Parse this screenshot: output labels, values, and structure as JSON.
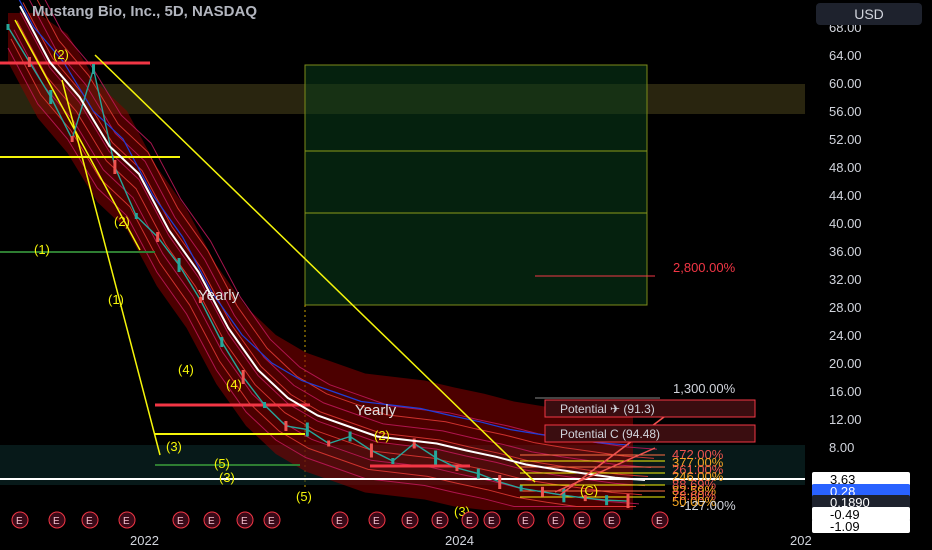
{
  "header": {
    "title": "Mustang Bio, Inc., 5D, NASDAQ",
    "currency": "USD"
  },
  "colors": {
    "background": "#000000",
    "price_axis_text": "#d1d4dc",
    "ma_red": "#c2185b",
    "ribbon": "#8b0000",
    "fib_yellow": "#f5f50a",
    "target_zone": "#0a3d1a",
    "current_price_line": "#ffffff"
  },
  "chart_data": {
    "type": "line",
    "title": "Mustang Bio, Inc., 5D, NASDAQ",
    "ylim": [
      -1.09,
      70
    ],
    "y_ticks": [
      "68.00",
      "64.00",
      "60.00",
      "56.00",
      "52.00",
      "48.00",
      "44.00",
      "40.00",
      "36.00",
      "32.00",
      "28.00",
      "24.00",
      "20.00",
      "16.00",
      "12.00",
      "8.00"
    ],
    "x_ticks": [
      "2022",
      "2024",
      "202"
    ],
    "price_badges": [
      {
        "value": "3.63",
        "style": "white"
      },
      {
        "value": "0.28",
        "style": "blue"
      },
      {
        "value": "0.1890",
        "style": "dark"
      },
      {
        "value": "-0.49",
        "style": "white"
      },
      {
        "value": "-1.09",
        "style": "white"
      }
    ],
    "series": [
      {
        "name": "Yearly",
        "values": [
          68,
          60,
          55,
          48,
          44,
          36,
          30,
          22,
          16,
          12,
          9.5,
          8,
          6.5,
          6,
          5.5,
          4.5,
          3.6,
          2.5,
          1.8,
          1.2,
          0.6,
          0.28
        ]
      }
    ],
    "price": [
      68,
      63,
      58,
      52,
      62,
      48,
      41,
      38,
      34,
      29,
      23,
      18,
      14,
      11,
      10.5,
      8.5,
      9.5,
      7.5,
      6,
      8.5,
      6.5,
      5,
      4.2,
      3,
      2.1,
      1.6,
      1.1,
      0.7,
      0.4,
      0.28
    ],
    "level_labels": [
      "2,800.00%",
      "1,300.00%",
      "472.00%",
      "377.00%",
      "261.00%",
      "246.00%",
      "88.69%",
      "82.59%",
      "78.60%",
      "50.00%",
      "-127.00%"
    ],
    "potential_labels": [
      "Potential ✈ (91.3)",
      "Potential C (94.48)"
    ],
    "wave_labels": [
      "(2)",
      "(1)",
      "(2)",
      "(1)",
      "(4)",
      "(4)",
      "(3)",
      "(5)",
      "(3)",
      "(5)",
      "(2)",
      "(3)",
      "(C)"
    ],
    "annotations": [
      "Yearly",
      "Yearly"
    ],
    "time_markers": [
      "E",
      "E",
      "E",
      "E",
      "E",
      "E",
      "E",
      "E",
      "E",
      "E",
      "E",
      "E",
      "E",
      "E",
      "E",
      "E",
      "E",
      "E",
      "E",
      "E",
      "E"
    ]
  }
}
